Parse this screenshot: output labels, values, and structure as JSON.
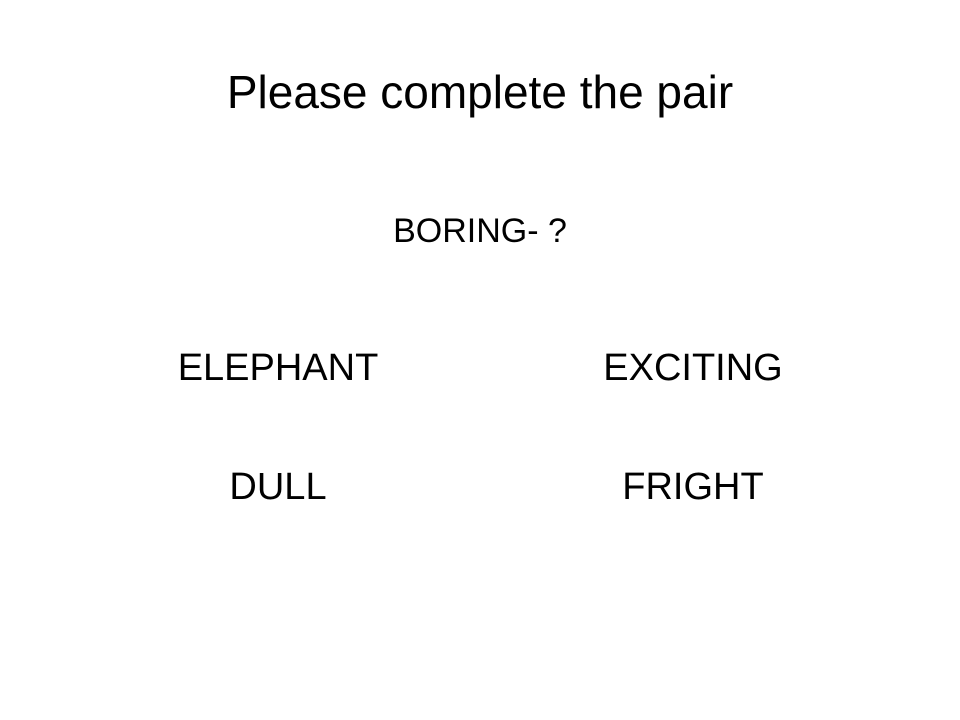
{
  "slide": {
    "title": "Please complete the pair",
    "prompt": "BORING- ?",
    "options": [
      "ELEPHANT",
      "EXCITING",
      "DULL",
      "FRIGHT"
    ]
  }
}
